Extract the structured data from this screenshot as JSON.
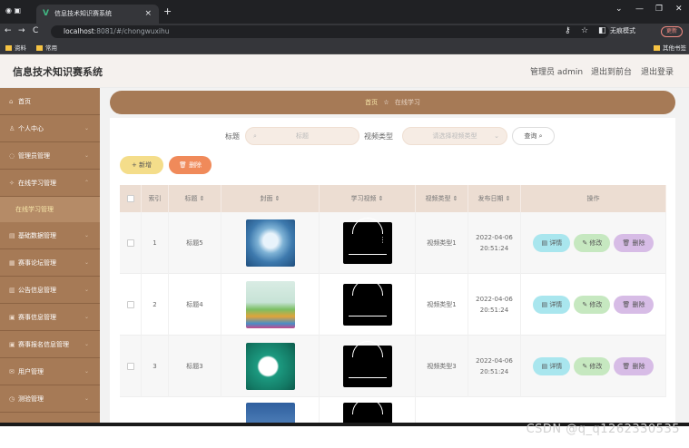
{
  "browser": {
    "tab_title": "信息技术知识赛系统",
    "tab_close": "×",
    "new_tab": "+",
    "url_host": "localhost",
    "url_path": ":8081/#/chongwuxihu",
    "incognito_label": "无痕模式",
    "update_label": "更新",
    "bookmarks": [
      "资料",
      "常用"
    ],
    "other_bookmarks": "其他书签"
  },
  "header": {
    "system_name": "信息技术知识赛系统",
    "admin": "管理员 admin",
    "back_front": "退出到前台",
    "logout": "退出登录"
  },
  "sidebar": {
    "items": [
      {
        "label": "首页",
        "icon": "home-icon"
      },
      {
        "label": "个人中心",
        "icon": "user-icon"
      },
      {
        "label": "管理员管理",
        "icon": "admin-icon"
      },
      {
        "label": "在线学习管理",
        "icon": "study-icon"
      },
      {
        "label": "基础数据管理",
        "icon": "data-icon"
      },
      {
        "label": "赛事论坛管理",
        "icon": "forum-icon"
      },
      {
        "label": "公告信息管理",
        "icon": "notice-icon"
      },
      {
        "label": "赛事信息管理",
        "icon": "event-icon"
      },
      {
        "label": "赛事报名信息管理",
        "icon": "signup-icon"
      },
      {
        "label": "用户管理",
        "icon": "users-icon"
      },
      {
        "label": "测验管理",
        "icon": "quiz-icon"
      }
    ],
    "submenu": "在线学习管理"
  },
  "breadcrumb": {
    "home": "首页",
    "current": "在线学习"
  },
  "search": {
    "title_label": "标题",
    "title_placeholder": "标题",
    "type_label": "视频类型",
    "type_placeholder": "请选择视频类型",
    "query_button": "查询"
  },
  "actions": {
    "add": "新增",
    "delete": "删除"
  },
  "table": {
    "headers": [
      "索引",
      "标题",
      "封面",
      "学习视频",
      "视频类型",
      "发布日期",
      "操作"
    ],
    "rows": [
      {
        "index": "1",
        "title": "标题5",
        "type": "视频类型1",
        "date": "2022-04-06",
        "time": "20:51:24"
      },
      {
        "index": "2",
        "title": "标题4",
        "type": "视频类型1",
        "date": "2022-04-06",
        "time": "20:51:24"
      },
      {
        "index": "3",
        "title": "标题3",
        "type": "视频类型3",
        "date": "2022-04-06",
        "time": "20:51:24"
      }
    ],
    "op_detail": "详情",
    "op_edit": "修改",
    "op_delete": "删除"
  },
  "watermark": "CSDN @q_q1262330535",
  "colors": {
    "brand": "#a67a56",
    "accent_yellow": "#f4dd8a",
    "accent_orange": "#f08a5a"
  }
}
